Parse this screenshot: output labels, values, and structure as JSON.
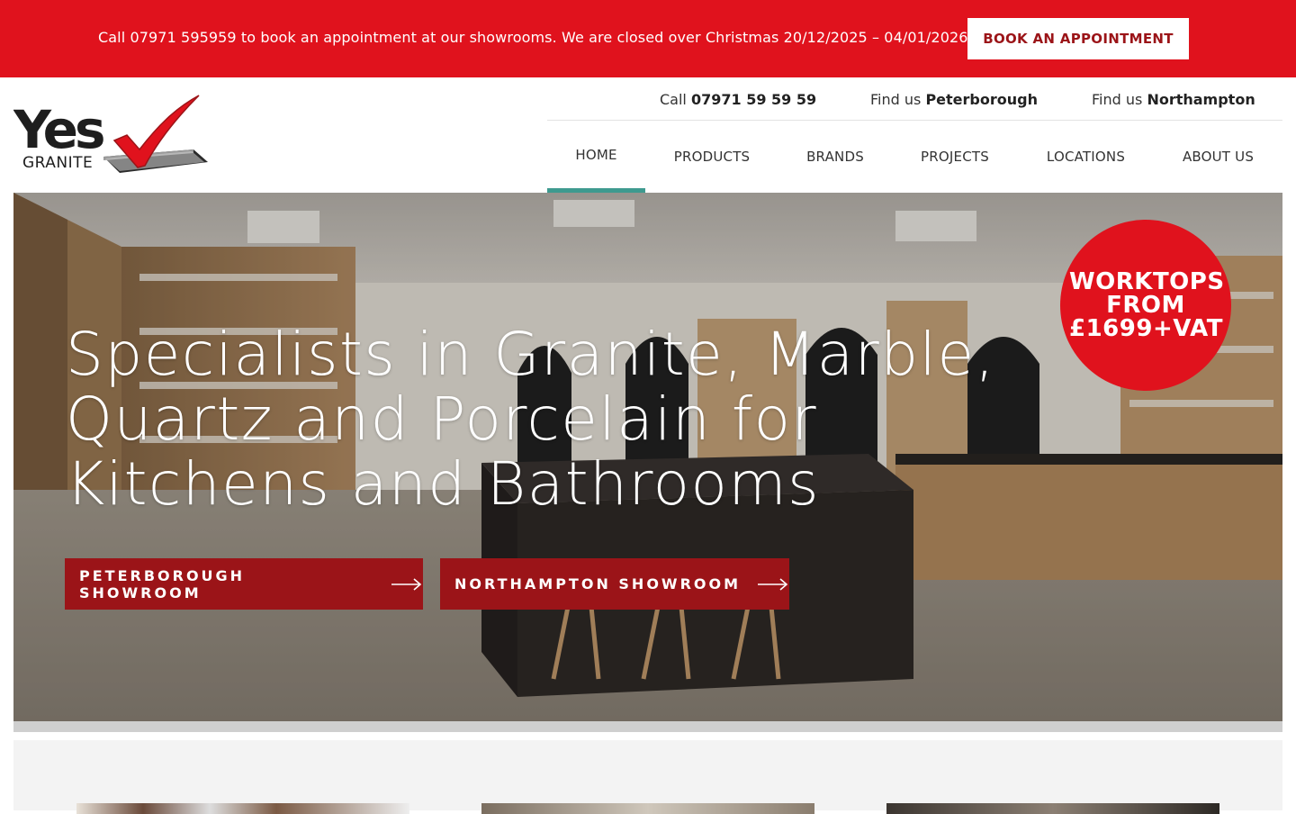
{
  "topbar": {
    "message": "Call 07971 595959 to book an appointment at our showrooms. We are closed over Christmas 20/12/2025 – 04/01/2026",
    "button_label": "BOOK AN APPOINTMENT"
  },
  "brand": {
    "logo_word": "Yes",
    "logo_sub": "GRANITE"
  },
  "contact": {
    "call_prefix": "Call",
    "call_number": "07971 59 59 59",
    "find1_prefix": "Find us",
    "find1_place": "Peterborough",
    "find2_prefix": "Find us",
    "find2_place": "Northampton"
  },
  "nav": {
    "items": [
      {
        "label": "HOME"
      },
      {
        "label": "PRODUCTS"
      },
      {
        "label": "BRANDS"
      },
      {
        "label": "PROJECTS"
      },
      {
        "label": "LOCATIONS"
      },
      {
        "label": "ABOUT US"
      }
    ],
    "active": "HOME"
  },
  "hero": {
    "title": "Specialists in Granite, Marble, Quartz and Porcelain for Kitchens and Bathrooms",
    "buttons": [
      {
        "label": "PETERBOROUGH SHOWROOM",
        "icon": "arrow-right-icon"
      },
      {
        "label": "NORTHAMPTON SHOWROOM",
        "icon": "arrow-right-icon"
      }
    ],
    "badge_text": "WORKTOPS FROM £1699+VAT"
  },
  "colors": {
    "brand_red": "#e0121d",
    "button_dark_red": "#9b1418",
    "nav_active_underline": "#3e9a8f"
  }
}
